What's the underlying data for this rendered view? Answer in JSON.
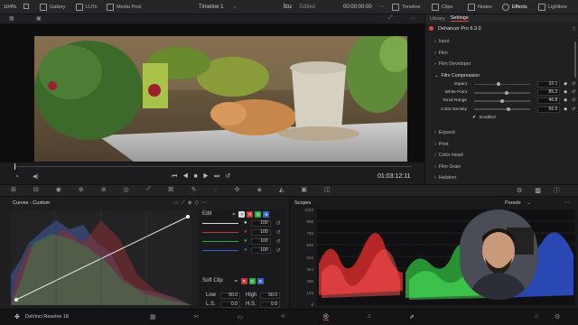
{
  "topbar": {
    "zoom": "104%",
    "tabs": [
      "Gallery",
      "LUTs",
      "Media Pool"
    ],
    "timeline": "Timeline 1",
    "clip_name": "lcu",
    "status": "Edited",
    "timecode": "00:00:00:00",
    "right_tabs": [
      "Timeline",
      "Clips",
      "Nodes",
      "Effects",
      "Lightbox"
    ]
  },
  "viewer": {
    "timecode": "01:03:12:11"
  },
  "effects": {
    "tabs": [
      "Library",
      "Settings"
    ],
    "plugin": "Dehancer Pro 6.3.0",
    "sections_top": [
      "Input",
      "Film",
      "Film Developer"
    ],
    "film_compression": "Film Compression",
    "sliders": [
      {
        "label": "Impact",
        "value": "32.1",
        "pct": 0.38
      },
      {
        "label": "White Point",
        "value": "85.3",
        "pct": 0.52
      },
      {
        "label": "Tonal Range",
        "value": "46.8",
        "pct": 0.44
      },
      {
        "label": "Color Density",
        "value": "56.9",
        "pct": 0.55
      }
    ],
    "enabled_label": "Enabled",
    "sections_bottom": [
      "Expand",
      "Print",
      "Color Head",
      "Film Grain",
      "Halation"
    ]
  },
  "curves": {
    "title": "Curves - Custom",
    "edit_label": "Edit",
    "channels": [
      {
        "label": "Y",
        "color": "#d8d8d8",
        "value": "100"
      },
      {
        "label": "R",
        "color": "#c83232",
        "value": "100"
      },
      {
        "label": "G",
        "color": "#2fa84a",
        "value": "100"
      },
      {
        "label": "B",
        "color": "#3560d0",
        "value": "100"
      }
    ],
    "soft_clip": "Soft Clip",
    "low_label": "Low",
    "low_value": "50.0",
    "high_label": "High",
    "high_value": "50.0",
    "ls_label": "L.S.",
    "ls_value": "0.0",
    "hs_label": "H.S.",
    "hs_value": "0.0"
  },
  "scopes": {
    "title": "Scopes",
    "mode": "Parade",
    "scale": [
      "1023",
      "896",
      "768",
      "640",
      "512",
      "384",
      "256",
      "128",
      "0"
    ]
  },
  "bottom": {
    "app_name": "DaVinci Resolve 18"
  },
  "colors": {
    "accent": "#e0453a",
    "panel": "#202022"
  }
}
